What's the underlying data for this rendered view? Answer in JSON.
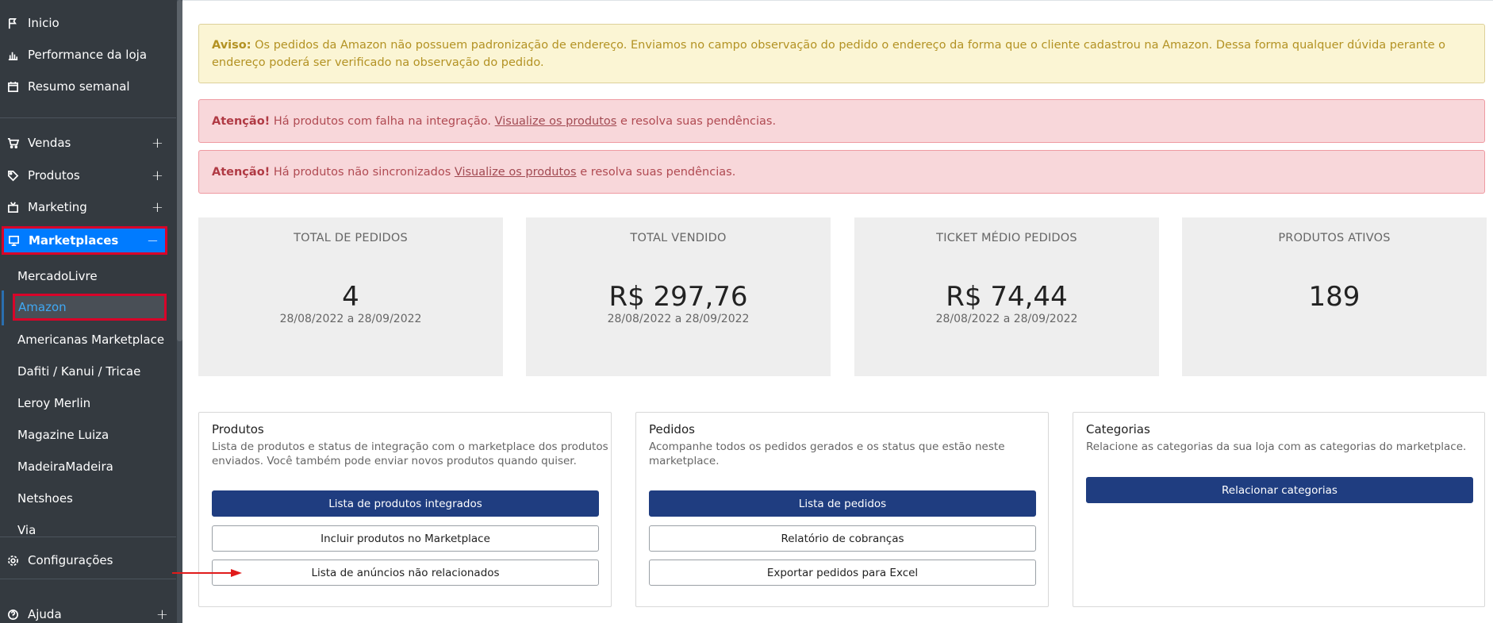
{
  "sidebar": {
    "top_items": [
      {
        "label": "Inicio",
        "icon": "flag-icon"
      },
      {
        "label": "Performance da loja",
        "icon": "bar-chart-icon"
      },
      {
        "label": "Resumo semanal",
        "icon": "calendar-icon"
      }
    ],
    "menu_items": [
      {
        "label": "Vendas",
        "icon": "cart-icon",
        "toggle": "+"
      },
      {
        "label": "Produtos",
        "icon": "tag-icon",
        "toggle": "+"
      },
      {
        "label": "Marketing",
        "icon": "tv-icon",
        "toggle": "+"
      }
    ],
    "marketplaces": {
      "label": "Marketplaces",
      "icon": "monitor-icon",
      "toggle": "−"
    },
    "sub_items": [
      "MercadoLivre",
      "Amazon",
      "Americanas Marketplace",
      "Dafiti / Kanui / Tricae",
      "Leroy Merlin",
      "Magazine Luiza",
      "MadeiraMadeira",
      "Netshoes",
      "Via"
    ],
    "config": {
      "label": "Configurações",
      "icon": "gear-icon"
    },
    "help": {
      "label": "Ajuda",
      "icon": "question-icon",
      "toggle": "+"
    }
  },
  "alerts": {
    "warning": {
      "label": "Aviso:",
      "text": " Os pedidos da Amazon não possuem padronização de endereço. Enviamos no campo observação do pedido o endereço da forma que o cliente cadastrou na Amazon. Dessa forma qualquer dúvida perante o endereço poderá ser verificado na observação do pedido."
    },
    "danger1": {
      "label": "Atenção!",
      "pre": " Há produtos com falha na integração. ",
      "link": "Visualize os produtos",
      "post": " e resolva suas pendências."
    },
    "danger2": {
      "label": "Atenção!",
      "pre": " Há produtos não sincronizados ",
      "link": "Visualize os produtos",
      "post": " e resolva suas pendências."
    }
  },
  "stats": [
    {
      "label": "TOTAL DE PEDIDOS",
      "value": "4",
      "period": "28/08/2022 a 28/09/2022"
    },
    {
      "label": "TOTAL VENDIDO",
      "value": "R$ 297,76",
      "period": "28/08/2022 a 28/09/2022"
    },
    {
      "label": "TICKET MÉDIO PEDIDOS",
      "value": "R$ 74,44",
      "period": "28/08/2022 a 28/09/2022"
    },
    {
      "label": "PRODUTOS ATIVOS",
      "value": "189",
      "period": ""
    }
  ],
  "panels": {
    "produtos": {
      "title": "Produtos",
      "desc1": "Lista de produtos e status de integração com o marketplace dos produtos",
      "desc2": "enviados. Você também pode enviar novos produtos quando quiser.",
      "btn_primary": "Lista de produtos integrados",
      "btn_2": "Incluir produtos no Marketplace",
      "btn_3": "Lista de anúncios não relacionados"
    },
    "pedidos": {
      "title": "Pedidos",
      "desc1": "Acompanhe todos os pedidos gerados e os status que estão neste",
      "desc2": "marketplace.",
      "btn_primary": "Lista de pedidos",
      "btn_2": "Relatório de cobranças",
      "btn_3": "Exportar pedidos para Excel"
    },
    "categorias": {
      "title": "Categorias",
      "desc1": "Relacione as categorias da sua loja com as categorias do marketplace.",
      "btn_primary": "Relacionar categorias"
    }
  },
  "colors": {
    "sidebar_bg": "#343a40",
    "active_blue": "#007bff",
    "highlight_red": "#d90429",
    "primary_button": "#1f3d80"
  }
}
